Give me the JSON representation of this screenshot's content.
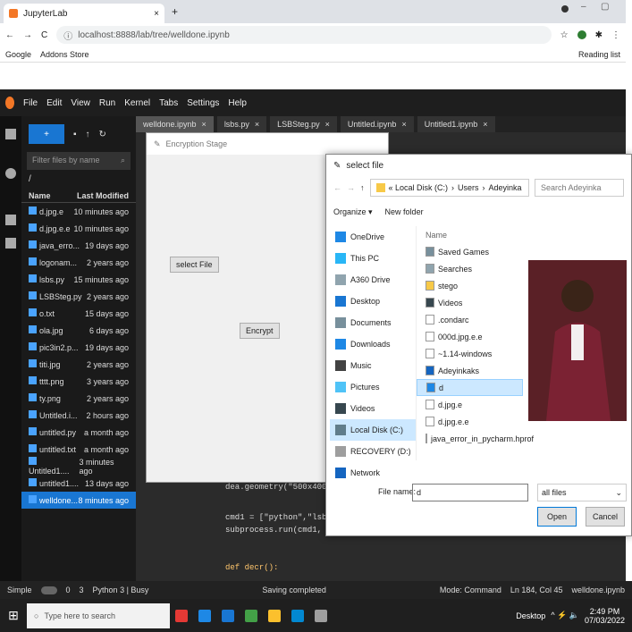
{
  "browser": {
    "tab_title": "JupyterLab",
    "tab_close": "×",
    "new_tab": "+",
    "url": "localhost:8888/lab/tree/welldone.ipynb",
    "bookmarks": [
      "Google",
      "Addons Store"
    ],
    "reading_list": "Reading list"
  },
  "jupyter": {
    "menu": [
      "File",
      "Edit",
      "View",
      "Run",
      "Kernel",
      "Tabs",
      "Settings",
      "Help"
    ],
    "filter_placeholder": "Filter files by name",
    "path": "/",
    "col_name": "Name",
    "col_modified": "Last Modified",
    "files": [
      {
        "name": "d.jpg.e",
        "modified": "10 minutes ago"
      },
      {
        "name": "d.jpg.e.e",
        "modified": "10 minutes ago"
      },
      {
        "name": "java_erro...",
        "modified": "19 days ago"
      },
      {
        "name": "logonam...",
        "modified": "2 years ago"
      },
      {
        "name": "lsbs.py",
        "modified": "15 minutes ago"
      },
      {
        "name": "LSBSteg.py",
        "modified": "2 years ago"
      },
      {
        "name": "o.txt",
        "modified": "15 days ago"
      },
      {
        "name": "ola.jpg",
        "modified": "6 days ago"
      },
      {
        "name": "pic3in2.p...",
        "modified": "19 days ago"
      },
      {
        "name": "titi.jpg",
        "modified": "2 years ago"
      },
      {
        "name": "tttt.png",
        "modified": "3 years ago"
      },
      {
        "name": "ty.png",
        "modified": "2 years ago"
      },
      {
        "name": "Untitled.i...",
        "modified": "2 hours ago"
      },
      {
        "name": "untitled.py",
        "modified": "a month ago"
      },
      {
        "name": "untitled.txt",
        "modified": "a month ago"
      },
      {
        "name": "Untitled1....",
        "modified": "3 minutes ago"
      },
      {
        "name": "untitled1....",
        "modified": "13 days ago"
      },
      {
        "name": "welldone...",
        "modified": "8 minutes ago"
      }
    ],
    "editor_tabs": [
      "welldone.ipynb",
      "lsbs.py",
      "LSBSteg.py",
      "Untitled.ipynb",
      "Untitled1.ipynb"
    ],
    "code_lines": [
      "dea.geometry(\"500x400+300+150\")",
      "cmd1 = [\"python\",\"lsbs.py\",\"-d\"",
      "subprocess.run(cmd1, shell=True",
      "def decr():"
    ]
  },
  "enc_window": {
    "title": "Encryption Stage",
    "select_file": "select File",
    "encrypt": "Encrypt"
  },
  "dialog": {
    "title": "select file",
    "crumb": [
      "« Local Disk (C:)",
      "Users",
      "Adeyinka"
    ],
    "search_placeholder": "Search Adeyinka",
    "organize": "Organize ▾",
    "new_folder": "New folder",
    "nav": [
      "OneDrive",
      "This PC",
      "A360 Drive",
      "Desktop",
      "Documents",
      "Downloads",
      "Music",
      "Pictures",
      "Videos",
      "Local Disk (C:)",
      "RECOVERY (D:)",
      "Network"
    ],
    "list_header": "Name",
    "items": [
      "Saved Games",
      "Searches",
      "stego",
      "Videos",
      ".condarc",
      "000d.jpg.e.e",
      "~1.14-windows",
      "Adeyinkaks",
      "d",
      "d.jpg.e",
      "d.jpg.e.e",
      "java_error_in_pycharm.hprof"
    ],
    "file_name_label": "File name:",
    "file_name": "d",
    "file_type": "all files",
    "open": "Open",
    "cancel": "Cancel"
  },
  "status": {
    "mode": "Simple",
    "kernel_counts": "0",
    "kernel_count2": "3",
    "kernel": "Python 3 | Busy",
    "saving": "Saving completed",
    "command_mode": "Mode: Command",
    "position": "Ln 184, Col 45",
    "file": "welldone.ipynb"
  },
  "taskbar": {
    "search_placeholder": "Type here to search",
    "desktop": "Desktop",
    "time": "2:49 PM",
    "date": "07/03/2022"
  }
}
